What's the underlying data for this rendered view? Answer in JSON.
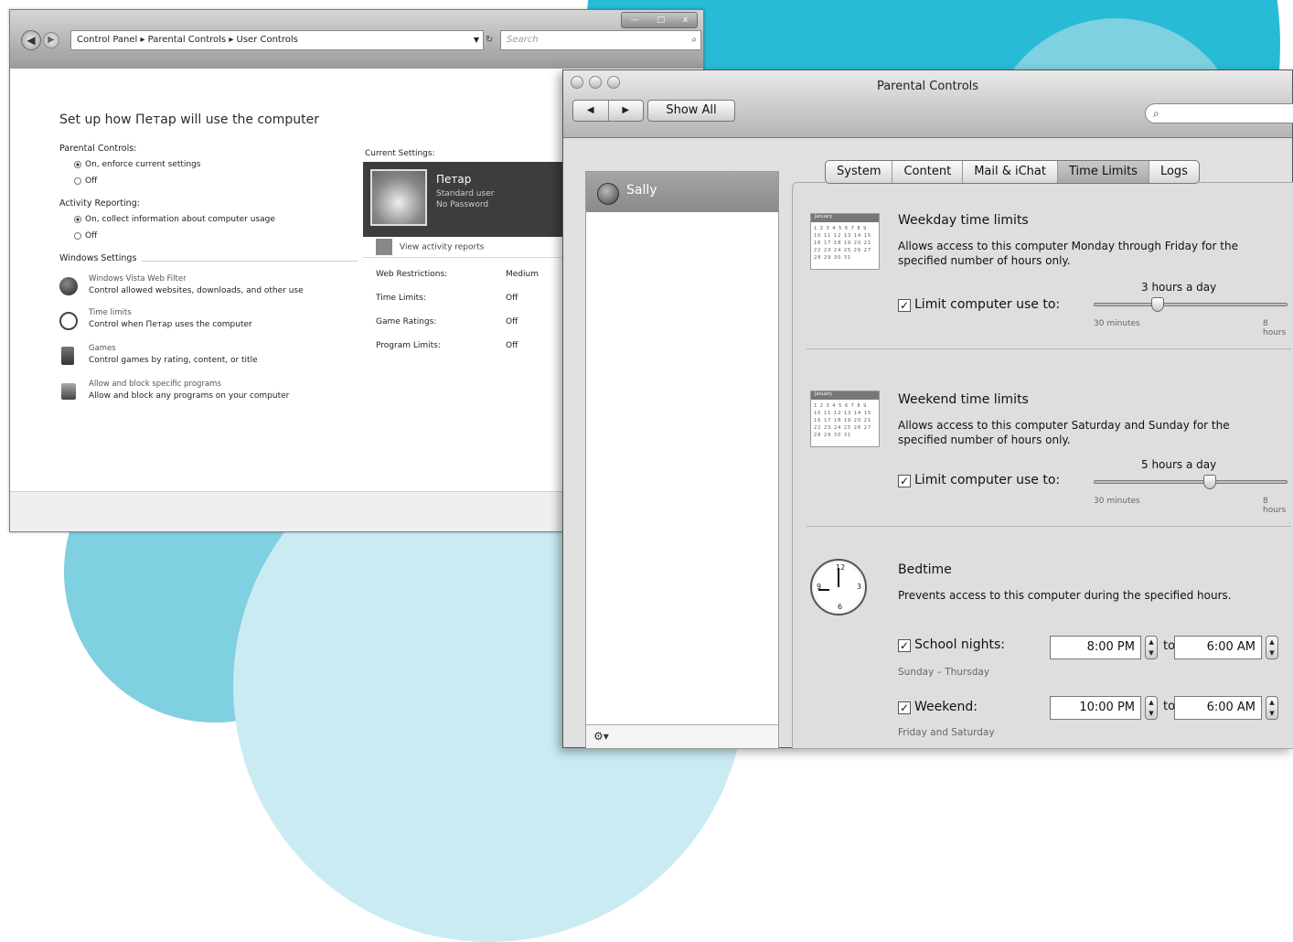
{
  "vista": {
    "address": "Control Panel  ▸  Parental Controls  ▸  User Controls",
    "search_placeholder": "Search",
    "title": "Set up how Петар will use the computer",
    "parental_controls_label": "Parental Controls:",
    "pc_on": "On, enforce current settings",
    "pc_off": "Off",
    "activity_label": "Activity Reporting:",
    "ar_on": "On, collect information about computer usage",
    "ar_off": "Off",
    "windows_settings_label": "Windows Settings",
    "settings": [
      {
        "link": "Windows Vista Web Filter",
        "desc": "Control allowed websites, downloads, and other use"
      },
      {
        "link": "Time limits",
        "desc": "Control when Петар uses the computer"
      },
      {
        "link": "Games",
        "desc": "Control games by rating, content, or title"
      },
      {
        "link": "Allow and block specific programs",
        "desc": "Allow and block any programs on your computer"
      }
    ],
    "current_settings_label": "Current Settings:",
    "user_name": "Петар",
    "user_type": "Standard user",
    "user_password": "No Password",
    "view_reports": "View activity reports",
    "current_rows": [
      {
        "label": "Web Restrictions:",
        "value": "Medium"
      },
      {
        "label": "Time Limits:",
        "value": "Off"
      },
      {
        "label": "Game Ratings:",
        "value": "Off"
      },
      {
        "label": "Program Limits:",
        "value": "Off"
      }
    ]
  },
  "mac": {
    "title": "Parental Controls",
    "show_all": "Show All",
    "search_glyph": "🔍",
    "user": "Sally",
    "tabs": [
      "System",
      "Content",
      "Mail & iChat",
      "Time Limits",
      "Logs"
    ],
    "active_tab": "Time Limits",
    "weekday": {
      "heading": "Weekday time limits",
      "desc": "Allows access to this computer Monday through Friday for the specified number of hours only.",
      "checkbox": "Limit computer use to:",
      "value": "3 hours a day",
      "min": "30 minutes",
      "max": "8 hours",
      "level": 0.33
    },
    "weekend": {
      "heading": "Weekend time limits",
      "desc": "Allows access to this computer Saturday and Sunday for the specified number of hours only.",
      "checkbox": "Limit computer use to:",
      "value": "5 hours a day",
      "min": "30 minutes",
      "max": "8 hours",
      "level": 0.6
    },
    "bedtime": {
      "heading": "Bedtime",
      "desc": "Prevents access to this computer during the specified hours.",
      "school_label": "School nights:",
      "school_days": "Sunday – Thursday",
      "school_from": "8:00 PM",
      "school_to": "6:00 AM",
      "weekend_label": "Weekend:",
      "weekend_days": "Friday and Saturday",
      "weekend_from": "10:00 PM",
      "weekend_to": "6:00 AM",
      "to": "to"
    }
  }
}
